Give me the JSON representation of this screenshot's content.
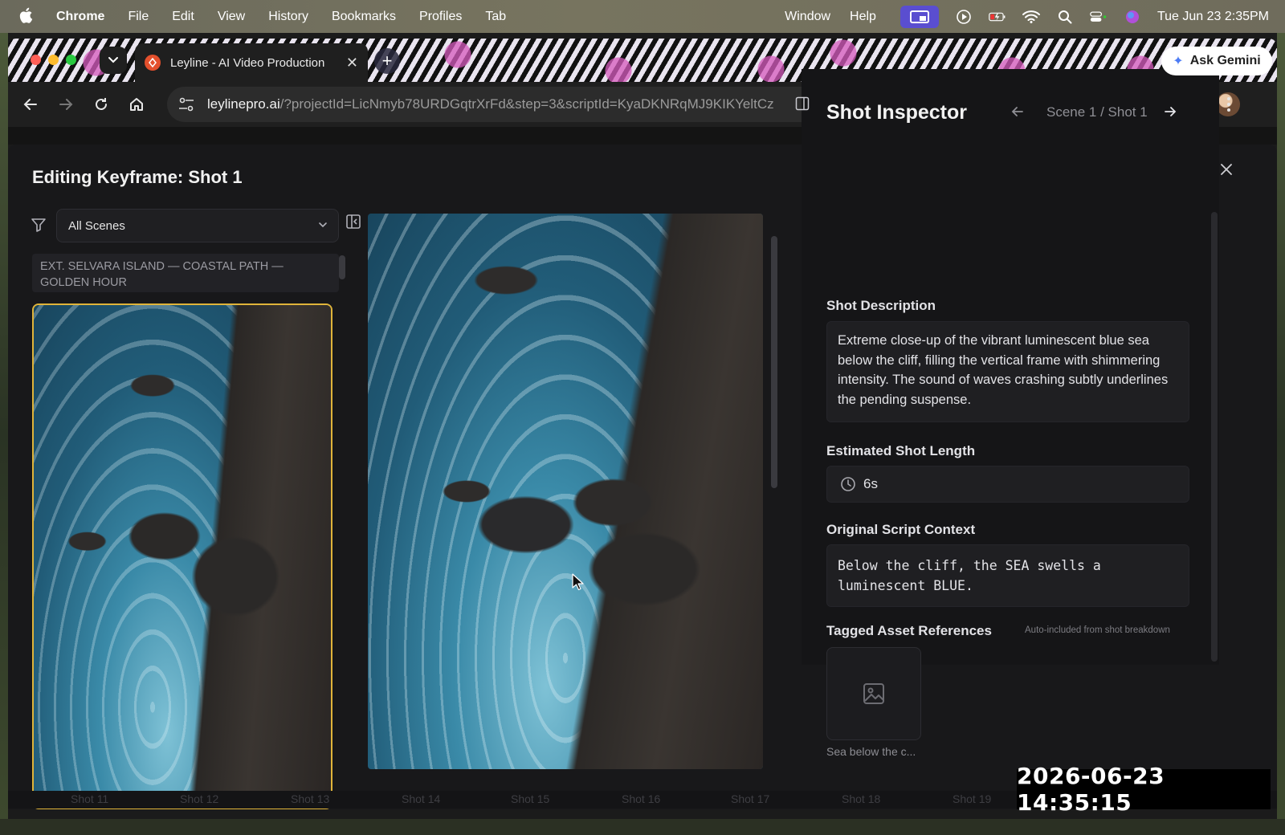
{
  "menubar": {
    "app": "Chrome",
    "items": [
      "File",
      "Edit",
      "View",
      "History",
      "Bookmarks",
      "Profiles",
      "Tab"
    ],
    "right_items": [
      "Window",
      "Help"
    ],
    "clock": "Tue Jun 23  2:35PM"
  },
  "browser": {
    "tab_title": "Leyline - AI Video Production",
    "ask_gemini": "Ask Gemini",
    "url_host": "leylinepro.ai",
    "url_rest": "/?projectId=LicNmyb78URDGqtrXrFd&step=3&scriptId=KyaDKNRqMJ9KIKYeltCz"
  },
  "modal": {
    "title": "Editing Keyframe: Shot 1",
    "scene_filter": "All Scenes",
    "scene_header": "EXT. SELVARA ISLAND — COASTAL PATH — GOLDEN HOUR"
  },
  "inspector": {
    "title": "Shot Inspector",
    "crumb": "Scene 1 / Shot 1",
    "desc_label": "Shot Description",
    "desc": "Extreme close-up of the vibrant luminescent blue sea below the cliff, filling the vertical frame with shimmering intensity. The sound of waves crashing subtly underlines the pending suspense.",
    "length_label": "Estimated Shot Length",
    "length_value": "6s",
    "script_label": "Original Script Context",
    "script": "Below the cliff, the SEA swells a luminescent BLUE.",
    "assets_label": "Tagged Asset References",
    "assets_note": "Auto-included from shot breakdown",
    "asset_caption": "Sea below the c..."
  },
  "shot_strip": [
    "Shot 11",
    "Shot 12",
    "Shot 13",
    "Shot 14",
    "Shot 15",
    "Shot 16",
    "Shot 17",
    "Shot 18",
    "Shot 19"
  ],
  "overlay": {
    "timestamp": "2026-06-23  14:35:15"
  },
  "colors": {
    "selected_border": "#e0b43a",
    "modal_bg": "#18181a",
    "favicon": "#e4502d",
    "screen_share_badge": "#5a4ed0"
  }
}
